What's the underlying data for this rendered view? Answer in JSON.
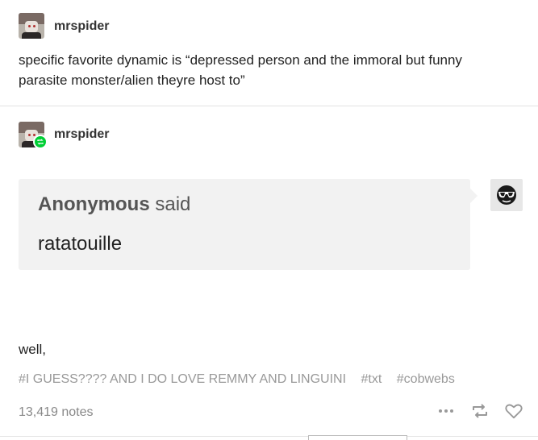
{
  "original_post": {
    "username": "mrspider",
    "text": "specific favorite dynamic is “depressed person and the immoral but funny parasite monster/alien theyre host to”"
  },
  "reblog": {
    "username": "mrspider",
    "ask": {
      "asker_name": "Anonymous",
      "asker_suffix": " said",
      "question": "ratatouille"
    },
    "answer": "well,",
    "tags": [
      "#I GUESS???? AND I DO LOVE REMMY AND LINGUINI",
      "#txt",
      "#cobwebs"
    ]
  },
  "footer": {
    "notes": "13,419 notes",
    "icons": [
      "more-options-icon",
      "reblog-icon",
      "like-heart-icon"
    ]
  },
  "colors": {
    "reblog_green": "#00cf35",
    "ask_background": "#f2f2f2",
    "tag_gray": "#999999"
  }
}
